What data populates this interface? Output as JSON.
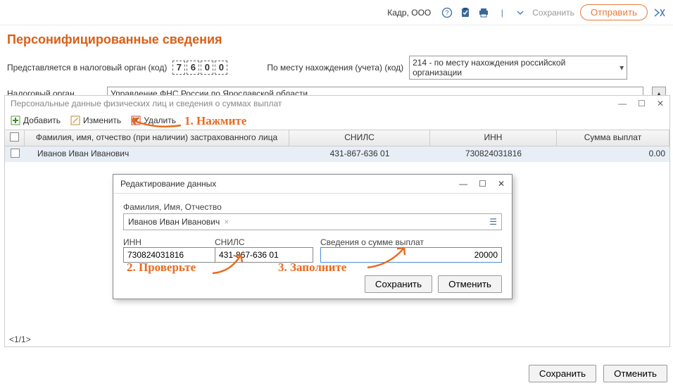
{
  "topbar": {
    "org": "Кадр, ООО",
    "save": "Сохранить",
    "send": "Отправить"
  },
  "title": "Персонифицированные сведения",
  "form": {
    "tax_label": "Представляется в налоговый орган (код)",
    "code": [
      "7",
      "6",
      "0",
      "0"
    ],
    "location_label": "По месту нахождения (учета) (код)",
    "location_value": "214 - по месту нахождения российской организации",
    "tax_org_label": "Налоговый орган",
    "tax_org_value": "Управление ФНС России по Ярославской области"
  },
  "subwindow": {
    "title": "Персональные данные физических лиц и сведения о суммах выплат",
    "toolbar": {
      "add": "Добавить",
      "edit": "Изменить",
      "del": "Удалить"
    },
    "annotations": {
      "a1": "1. Нажмите",
      "a2": "2. Проверьте",
      "a3": "3. Заполните"
    },
    "columns": {
      "fio": "Фамилия, имя, отчество (при наличии) застрахованного лица",
      "snils": "СНИЛС",
      "inn": "ИНН",
      "sum": "Сумма выплат"
    },
    "row": {
      "fio": "Иванов Иван Иванович",
      "snils": "431-867-636 01",
      "inn": "730824031816",
      "sum": "0.00"
    },
    "pager": "<1/1>"
  },
  "dialog": {
    "title": "Редактирование данных",
    "fio_label": "Фамилия, Имя, Отчество",
    "fio_value": "Иванов Иван Иванович",
    "inn_label": "ИНН",
    "inn_value": "730824031816",
    "snils_label": "СНИЛС",
    "snils_value": "431-867-636 01",
    "sum_label": "Сведения о сумме выплат",
    "sum_value": "20000",
    "save": "Сохранить",
    "cancel": "Отменить"
  },
  "footer": {
    "save": "Сохранить",
    "cancel": "Отменить"
  }
}
